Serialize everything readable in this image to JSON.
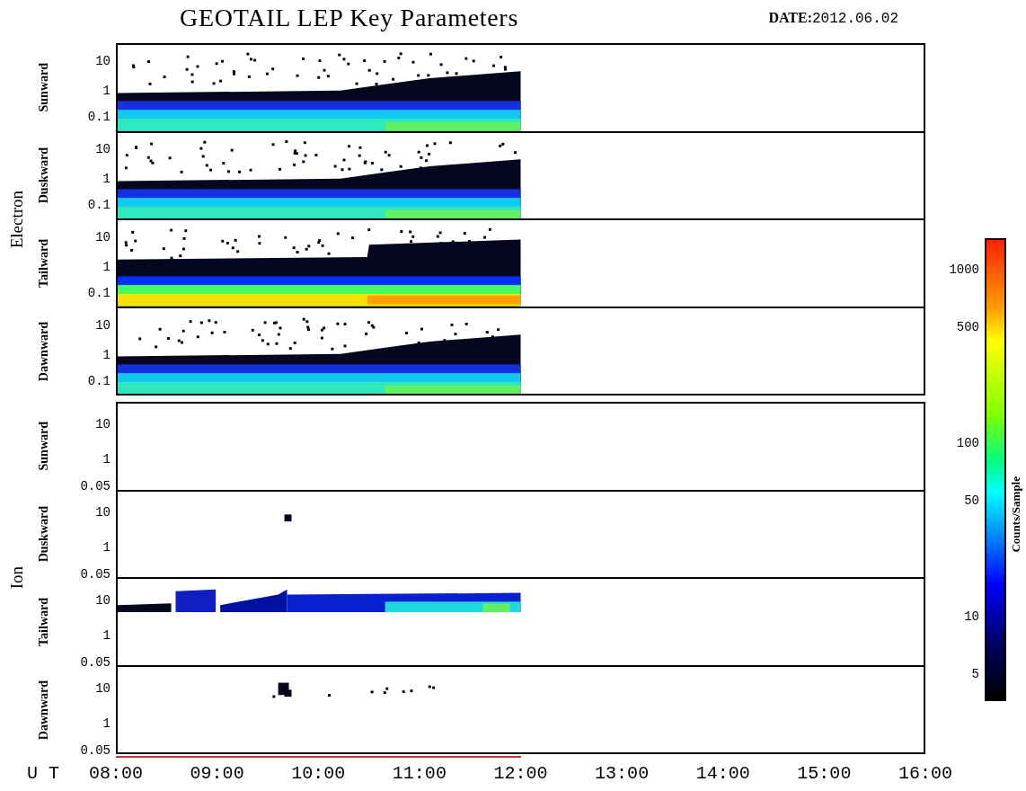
{
  "title": "GEOTAIL LEP Key Parameters",
  "date": {
    "label": "DATE:",
    "value": "2012.06.02"
  },
  "groups": [
    {
      "name": "Electron",
      "panels": [
        {
          "name": "Sunward",
          "yticks": [
            "10",
            "1",
            "0.1"
          ]
        },
        {
          "name": "Duskward",
          "yticks": [
            "10",
            "1",
            "0.1"
          ]
        },
        {
          "name": "Tailward",
          "yticks": [
            "10",
            "1",
            "0.1"
          ]
        },
        {
          "name": "Dawnward",
          "yticks": [
            "10",
            "1",
            "0.1"
          ]
        }
      ]
    },
    {
      "name": "Ion",
      "panels": [
        {
          "name": "Sunward",
          "yticks": [
            "10",
            "1",
            "0.05"
          ]
        },
        {
          "name": "Duskward",
          "yticks": [
            "10",
            "1",
            "0.05"
          ]
        },
        {
          "name": "Tailward",
          "yticks": [
            "10",
            "1",
            "0.05"
          ]
        },
        {
          "name": "Dawnward",
          "yticks": [
            "10",
            "1",
            "0.05"
          ]
        }
      ]
    }
  ],
  "xaxis": {
    "label": "U T",
    "ticks": [
      "08:00",
      "09:00",
      "10:00",
      "11:00",
      "12:00",
      "13:00",
      "14:00",
      "15:00",
      "16:00"
    ]
  },
  "colorbar": {
    "label": "Counts/Sample",
    "ticks": [
      "1000",
      "500",
      "100",
      "50",
      "10",
      "5"
    ]
  }
}
